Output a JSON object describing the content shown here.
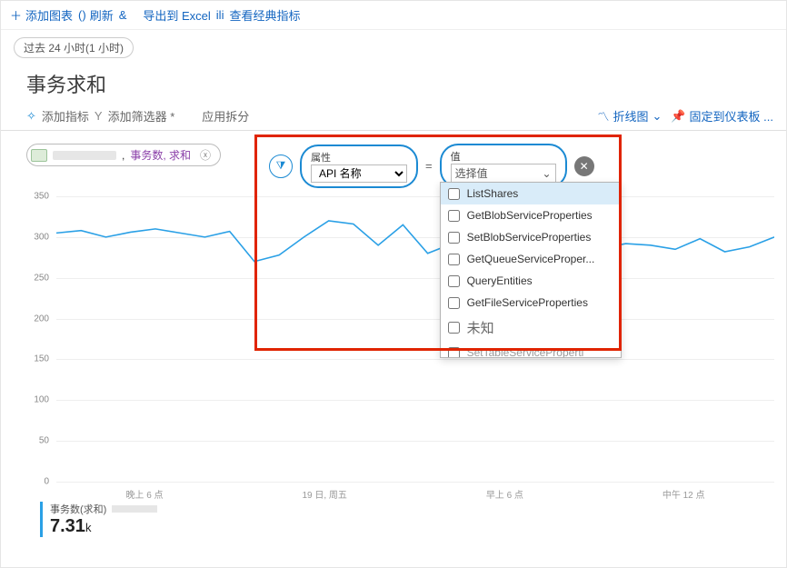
{
  "toolbar": {
    "add_chart": "添加图表",
    "refresh": "刷新",
    "amp": "&",
    "export": "导出到 Excel",
    "classic": "查看经典指标",
    "ili": "ili"
  },
  "time_range": "过去 24 小时(1 小时)",
  "title": "事务求和",
  "sub": {
    "add_metric": "添加指标",
    "add_filter": "添加筛选器 *",
    "apply_split": "应用拆分",
    "line_chart": "折线图",
    "pin": "固定到仪表板 ..."
  },
  "metric_pill": {
    "text": "事务数, 求和"
  },
  "filter": {
    "attr_label": "属性",
    "attr_value": "API 名称",
    "val_label": "值",
    "val_placeholder": "选择值"
  },
  "dropdown_options": [
    "ListShares",
    "GetBlobServiceProperties",
    "SetBlobServiceProperties",
    "GetQueueServiceProper...",
    "QueryEntities",
    "GetFileServiceProperties",
    "未知",
    "SetTableServiceProperti"
  ],
  "chart_data": {
    "type": "line",
    "ylim": [
      0,
      350
    ],
    "yticks": [
      0,
      50,
      100,
      150,
      200,
      250,
      300,
      350
    ],
    "x_labels": [
      "晚上 6 点",
      "19 日, 周五",
      "早上 6 点",
      "中午 12 点"
    ],
    "series": [
      {
        "name": "事务数(求和)",
        "color": "#2aa0e6",
        "values": [
          305,
          308,
          300,
          306,
          310,
          305,
          300,
          307,
          270,
          278,
          300,
          320,
          316,
          290,
          315,
          280,
          292,
          298,
          275,
          280,
          295,
          297,
          286,
          292,
          290,
          285,
          298,
          282,
          288,
          300
        ]
      }
    ]
  },
  "legend": {
    "label": "事务数(求和)",
    "value": "7.31",
    "unit": "k"
  }
}
